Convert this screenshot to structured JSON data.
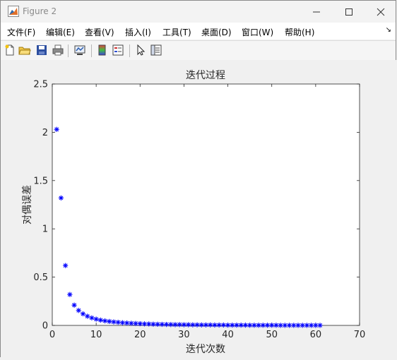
{
  "window": {
    "title": "Figure 2"
  },
  "menu": [
    "文件(F)",
    "编辑(E)",
    "查看(V)",
    "插入(I)",
    "工具(T)",
    "桌面(D)",
    "窗口(W)",
    "帮助(H)"
  ],
  "menu_overflow_icon": "expand-arrow-icon",
  "toolbar": {
    "buttons": [
      "new-figure-icon",
      "open-file-icon",
      "save-icon",
      "print-icon",
      "link-plot-icon",
      "colorbar-icon",
      "legend-icon",
      "edit-plot-arrow-icon",
      "property-inspector-icon"
    ]
  },
  "chart_data": {
    "type": "scatter",
    "title": "迭代过程",
    "xlabel": "迭代次数",
    "ylabel": "对偶误差",
    "xlim": [
      0,
      70
    ],
    "ylim": [
      0,
      2.5
    ],
    "xticks": [
      "0",
      "10",
      "20",
      "30",
      "40",
      "50",
      "60",
      "70"
    ],
    "yticks": [
      "0",
      "0.5",
      "1",
      "1.5",
      "2",
      "2.5"
    ],
    "marker": "*",
    "color": "#0000ff",
    "grid": false,
    "x": [
      1,
      2,
      3,
      4,
      5,
      6,
      7,
      8,
      9,
      10,
      11,
      12,
      13,
      14,
      15,
      16,
      17,
      18,
      19,
      20,
      21,
      22,
      23,
      24,
      25,
      26,
      27,
      28,
      29,
      30,
      31,
      32,
      33,
      34,
      35,
      36,
      37,
      38,
      39,
      40,
      41,
      42,
      43,
      44,
      45,
      46,
      47,
      48,
      49,
      50,
      51,
      52,
      53,
      54,
      55,
      56,
      57,
      58,
      59,
      60,
      61
    ],
    "y": [
      2.03,
      1.32,
      0.62,
      0.32,
      0.21,
      0.155,
      0.12,
      0.095,
      0.078,
      0.065,
      0.055,
      0.047,
      0.041,
      0.036,
      0.032,
      0.028,
      0.025,
      0.022,
      0.02,
      0.018,
      0.016,
      0.015,
      0.013,
      0.012,
      0.011,
      0.01,
      0.009,
      0.008,
      0.008,
      0.007,
      0.007,
      0.006,
      0.006,
      0.005,
      0.005,
      0.005,
      0.004,
      0.004,
      0.004,
      0.003,
      0.003,
      0.003,
      0.003,
      0.003,
      0.002,
      0.002,
      0.002,
      0.002,
      0.002,
      0.002,
      0.002,
      0.001,
      0.001,
      0.001,
      0.001,
      0.001,
      0.001,
      0.001,
      0.001,
      0.001,
      0.001
    ]
  }
}
